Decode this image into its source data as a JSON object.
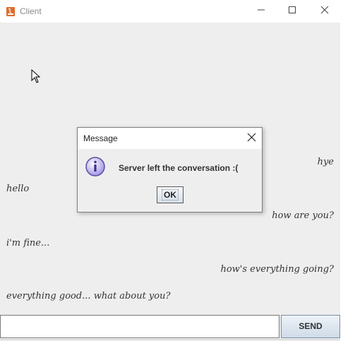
{
  "window": {
    "title": "Client",
    "min_icon": "minimize-icon",
    "max_icon": "maximize-icon",
    "close_icon": "close-icon"
  },
  "chat": {
    "messages": [
      {
        "side": "right",
        "text": "hye"
      },
      {
        "side": "left",
        "text": "hello"
      },
      {
        "side": "right",
        "text": "how are you?"
      },
      {
        "side": "left",
        "text": "i'm fine..."
      },
      {
        "side": "right",
        "text": "how's everything going?"
      },
      {
        "side": "left",
        "text": "everything good... what about you?"
      }
    ]
  },
  "input": {
    "value": "",
    "send_label": "SEND"
  },
  "dialog": {
    "title": "Message",
    "message": "Server left the conversation :(",
    "ok_label": "OK",
    "icon": "info-icon"
  }
}
